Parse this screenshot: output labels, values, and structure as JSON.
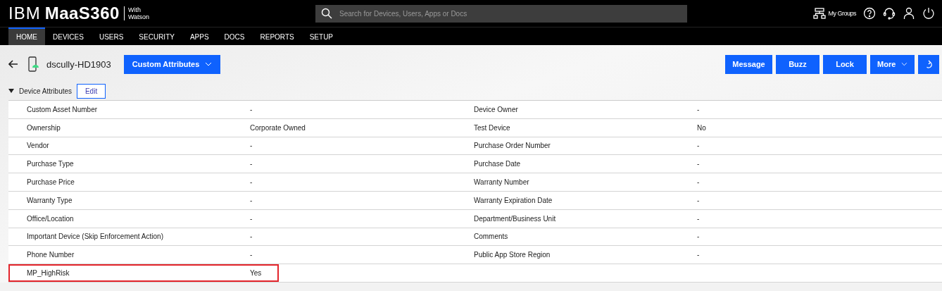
{
  "brand": {
    "ibm": "IBM",
    "product": "MaaS360",
    "with": "With",
    "watson": "Watson"
  },
  "search": {
    "placeholder": "Search for Devices, Users, Apps or Docs"
  },
  "header_actions": {
    "groups": "My Groups"
  },
  "nav": [
    {
      "label": "HOME",
      "selected": true
    },
    {
      "label": "DEVICES",
      "selected": false
    },
    {
      "label": "USERS",
      "selected": false
    },
    {
      "label": "SECURITY",
      "selected": false
    },
    {
      "label": "APPS",
      "selected": false
    },
    {
      "label": "DOCS",
      "selected": false
    },
    {
      "label": "REPORTS",
      "selected": false
    },
    {
      "label": "SETUP",
      "selected": false
    }
  ],
  "device": {
    "name": "dscully-HD1903",
    "dropdown": "Custom Attributes"
  },
  "actions": [
    "Message",
    "Buzz",
    "Lock",
    "More"
  ],
  "section": {
    "title": "Device Attributes",
    "expanded": true,
    "edit": "Edit"
  },
  "rows": [
    {
      "label": "Custom Asset Number",
      "value": "-",
      "label2": "Device Owner",
      "value2": "-"
    },
    {
      "label": "Ownership",
      "value": "Corporate Owned",
      "label2": "Test Device",
      "value2": "No"
    },
    {
      "label": "Vendor",
      "value": "-",
      "label2": "Purchase Order Number",
      "value2": "-"
    },
    {
      "label": "Purchase Type",
      "value": "-",
      "label2": "Purchase Date",
      "value2": "-"
    },
    {
      "label": "Purchase Price",
      "value": "-",
      "label2": "Warranty Number",
      "value2": "-"
    },
    {
      "label": "Warranty Type",
      "value": "-",
      "label2": "Warranty Expiration Date",
      "value2": "-"
    },
    {
      "label": "Office/Location",
      "value": "-",
      "label2": "Department/Business Unit",
      "value2": "-"
    },
    {
      "label": "Important Device (Skip Enforcement Action)",
      "value": "-",
      "label2": "Comments",
      "value2": "-"
    },
    {
      "label": "Phone Number",
      "value": "-",
      "label2": "Public App Store Region",
      "value2": "-"
    },
    {
      "label": "MP_HighRisk",
      "value": "Yes",
      "highlighted": true
    }
  ]
}
